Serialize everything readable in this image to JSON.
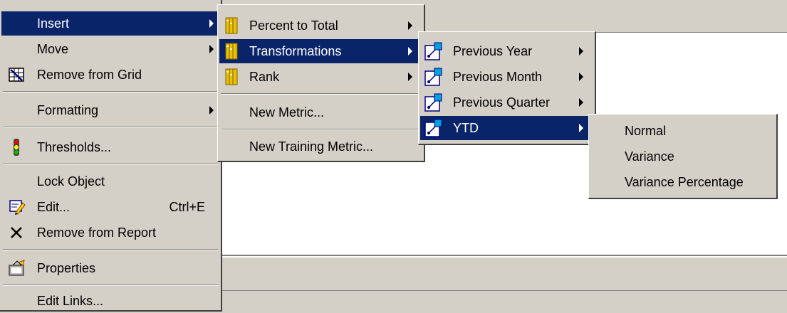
{
  "context_menu": {
    "items": [
      {
        "label": "Insert",
        "arrow": true,
        "highlighted": true
      },
      {
        "label": "Move",
        "arrow": true
      },
      {
        "label": "Remove from Grid",
        "icon": "remove-from-grid-icon"
      },
      {
        "label": "Formatting",
        "arrow": true
      },
      {
        "label": "Thresholds...",
        "icon": "thresholds-icon"
      },
      {
        "label": "Lock Object"
      },
      {
        "label": "Edit...",
        "shortcut": "Ctrl+E",
        "icon": "edit-icon"
      },
      {
        "label": "Remove from Report",
        "icon": "remove-x-icon"
      },
      {
        "label": "Properties",
        "icon": "properties-icon"
      },
      {
        "label": "Edit Links..."
      }
    ]
  },
  "insert_submenu": {
    "items": [
      {
        "label": "Percent to Total",
        "arrow": true,
        "icon": "metric-folder-icon"
      },
      {
        "label": "Transformations",
        "arrow": true,
        "icon": "metric-folder-icon",
        "highlighted": true
      },
      {
        "label": "Rank",
        "arrow": true,
        "icon": "metric-folder-icon"
      },
      {
        "label": "New Metric..."
      },
      {
        "label": "New Training Metric..."
      }
    ]
  },
  "transformations_submenu": {
    "items": [
      {
        "label": "Previous Year",
        "arrow": true,
        "icon": "transformation-icon"
      },
      {
        "label": "Previous Month",
        "arrow": true,
        "icon": "transformation-icon"
      },
      {
        "label": "Previous Quarter",
        "arrow": true,
        "icon": "transformation-icon"
      },
      {
        "label": "YTD",
        "arrow": true,
        "icon": "transformation-icon",
        "highlighted": true
      }
    ]
  },
  "ytd_submenu": {
    "items": [
      {
        "label": "Normal"
      },
      {
        "label": "Variance"
      },
      {
        "label": "Variance Percentage"
      }
    ]
  },
  "colors": {
    "menu_bg": "#d4d0c8",
    "highlight_bg": "#0a246a",
    "highlight_text": "#ffffff"
  }
}
